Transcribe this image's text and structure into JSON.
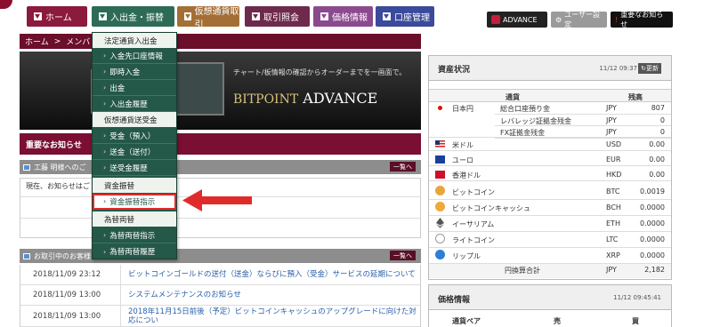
{
  "nav": {
    "home": "ホーム",
    "deposit": "入出金・振替",
    "crypto": "仮想通貨取引",
    "trade": "取引照会",
    "price": "価格情報",
    "account": "口座管理",
    "advance": "ADVANCE",
    "user_settings": "ユーザー設定",
    "important": "重要なお知らせ"
  },
  "breadcrumb": {
    "home": "ホーム",
    "sep": ">",
    "current": "メンバ"
  },
  "banner": {
    "tagline": "チャート/板情報の確認からオーダーまでを一画面で。",
    "brand_bit": "BITPOINT",
    "brand_adv": "ADVANCE"
  },
  "dropdown": {
    "groups": [
      {
        "header": "法定通貨入出金",
        "items": [
          "入金先口座情報",
          "即時入金",
          "出金",
          "入出金履歴"
        ]
      },
      {
        "header": "仮想通貨送受金",
        "items": [
          "受金（預入）",
          "送金（送付）",
          "送受金履歴"
        ]
      },
      {
        "header": "資金振替",
        "items": [
          "資金振替指示"
        ]
      },
      {
        "header": "為替両替",
        "items": [
          "為替両替指示",
          "為替両替履歴"
        ]
      }
    ],
    "chevron": "›"
  },
  "notices": {
    "title": "重要なお知らせ",
    "sub_title": "工藤 明様へのご",
    "more": "一覧へ",
    "message": "現在、お知らせはご"
  },
  "customer": {
    "sub_title": "お取引中のお客様",
    "more": "一覧へ",
    "rows": [
      {
        "date": "2018/11/09 23:12",
        "title": "ビットコインゴールドの送付（送金）ならびに預入（受金）サービスの延期について"
      },
      {
        "date": "2018/11/09 13:00",
        "title": "システムメンテナンスのお知らせ"
      },
      {
        "date": "2018/11/09 13:00",
        "title": "2018年11月15日前後（予定）ビットコインキャッシュのアップグレードに向けた対応につい"
      }
    ]
  },
  "assets": {
    "title": "資産状況",
    "timestamp": "11/12 09:37",
    "update": "更新",
    "col_currency": "通貨",
    "col_balance": "残高",
    "jpy_name": "日本円",
    "jpy_rows": [
      {
        "label": "総合口座預り金",
        "cur": "JPY",
        "val": "807"
      },
      {
        "label": "レバレッジ証拠金残金",
        "cur": "JPY",
        "val": "0"
      },
      {
        "label": "FX証拠金残金",
        "cur": "JPY",
        "val": "0"
      }
    ],
    "rows": [
      {
        "name": "米ドル",
        "cur": "USD",
        "val": "0.00"
      },
      {
        "name": "ユーロ",
        "cur": "EUR",
        "val": "0.00"
      },
      {
        "name": "香港ドル",
        "cur": "HKD",
        "val": "0.00"
      },
      {
        "name": "ビットコイン",
        "cur": "BTC",
        "val": "0.0019"
      },
      {
        "name": "ビットコインキャッシュ",
        "cur": "BCH",
        "val": "0.0000"
      },
      {
        "name": "イーサリアム",
        "cur": "ETH",
        "val": "0.0000"
      },
      {
        "name": "ライトコイン",
        "cur": "LTC",
        "val": "0.0000"
      },
      {
        "name": "リップル",
        "cur": "XRP",
        "val": "0.0000"
      }
    ],
    "total_label": "円換算合計",
    "total_cur": "JPY",
    "total_val": "2,182"
  },
  "price_info": {
    "title": "価格情報",
    "timestamp": "11/12 09:45:41",
    "col_pair": "通貨ペア",
    "col_sell": "売",
    "col_buy": "買"
  },
  "colors": {
    "brand": "#7a0f33",
    "menu": "#245848",
    "arrow": "#e02b2b"
  }
}
